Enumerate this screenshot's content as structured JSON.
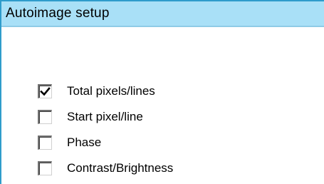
{
  "window": {
    "title": "Autoimage setup"
  },
  "options": [
    {
      "label": "Total pixels/lines",
      "checked": true
    },
    {
      "label": "Start pixel/line",
      "checked": false
    },
    {
      "label": "Phase",
      "checked": false
    },
    {
      "label": "Contrast/Brightness",
      "checked": false
    }
  ],
  "colors": {
    "titlebar_background": "#a9e0f7",
    "window_border": "#2f9ccb"
  },
  "icons": {
    "checked": "checkmark-icon"
  }
}
